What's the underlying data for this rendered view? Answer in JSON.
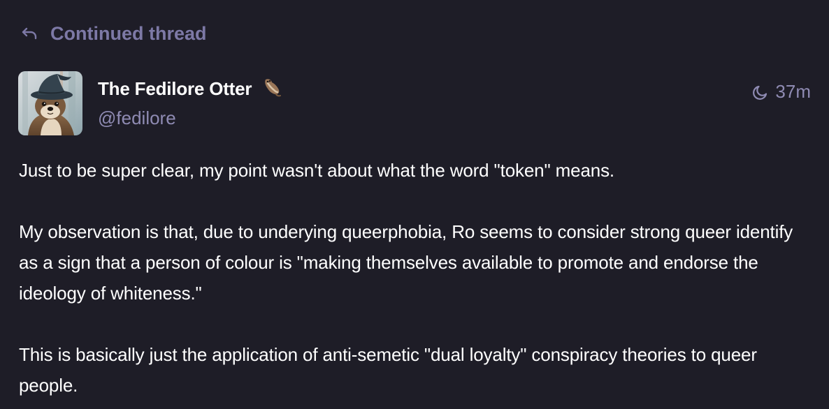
{
  "thread": {
    "label": "Continued thread",
    "icon": "reply-icon"
  },
  "author": {
    "display_name": "The Fedilore Otter",
    "emoji_icon": "otter-emoji-icon",
    "handle": "@fedilore",
    "avatar_icon": "otter-wizard-avatar"
  },
  "meta": {
    "visibility_icon": "moon-icon",
    "time_ago": "37m"
  },
  "content": {
    "paragraphs": [
      "Just to be super clear, my point wasn't about what the word \"token\" means.",
      "My observation is that, due to underying queerphobia, Ro seems to consider strong queer identify as a sign that a person of colour is \"making themselves available to promote and endorse the ideology of whiteness.\"",
      "This is basically just the application of anti-semetic \"dual loyalty\" conspiracy theories to queer people."
    ]
  },
  "colors": {
    "background": "#1e1d27",
    "muted": "#8f8bb3",
    "accent_muted": "#7d79a6",
    "text": "#ffffff"
  }
}
